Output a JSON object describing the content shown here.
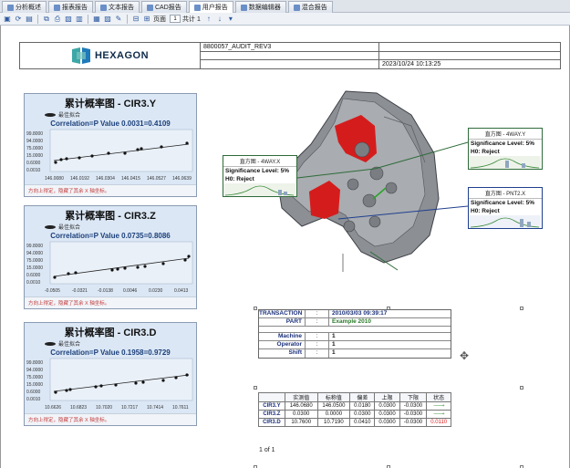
{
  "tabs": [
    {
      "label": "分析概述",
      "active": false
    },
    {
      "label": "报表报告",
      "active": false
    },
    {
      "label": "文本报告",
      "active": false
    },
    {
      "label": "CAD报告",
      "active": false
    },
    {
      "label": "用户报告",
      "active": true
    },
    {
      "label": "数据编辑器",
      "active": false
    },
    {
      "label": "混合报告",
      "active": false
    }
  ],
  "toolbar": {
    "page_label": "页面",
    "page_value": "1",
    "of_label": "共计 1"
  },
  "header": {
    "logo": "HEXAGON",
    "part_name": "8800057_AUDIT_REV3",
    "datetime": "2023/10/24 10:13:25"
  },
  "prob_charts": [
    {
      "title": "累计概率图 - CIR3.Y",
      "legend": "最佳拟合",
      "correlation": "Correlation=P Value 0.0031=0.4109",
      "y_ticks": [
        "99.8000",
        "94.0000",
        "75.0000",
        "15.0000",
        "0.6000",
        "0.0010"
      ],
      "x_ticks": [
        "146.0080",
        "146.0192",
        "146.0304",
        "146.0415",
        "146.0527",
        "146.0639"
      ],
      "note": "方向上得定，隐藏了其余 X 轴坐标。"
    },
    {
      "title": "累计概率图 - CIR3.Z",
      "legend": "最佳拟合",
      "correlation": "Correlation=P Value 0.0735=0.8086",
      "y_ticks": [
        "99.8000",
        "94.0000",
        "75.0000",
        "15.0000",
        "0.6000",
        "0.0010"
      ],
      "x_ticks": [
        "-0.0505",
        "-0.0321",
        "-0.0138",
        "0.0046",
        "0.0230",
        "0.0413"
      ],
      "note": "方向上得定，隐藏了其余 X 轴坐标。"
    },
    {
      "title": "累计概率图 - CIR3.D",
      "legend": "最佳拟合",
      "correlation": "Correlation=P Value 0.1958=0.9729",
      "y_ticks": [
        "99.8000",
        "94.0000",
        "75.0000",
        "15.0000",
        "0.6000",
        "0.0010"
      ],
      "x_ticks": [
        "10.6626",
        "10.6823",
        "10.7020",
        "10.7217",
        "10.7414",
        "10.7611"
      ],
      "note": "方向上得定，隐藏了其余 X 轴坐标。"
    }
  ],
  "callouts": [
    {
      "header": "直方图 - 4WAY.X",
      "l1": "Significance Level: 5%",
      "l2": "H0: Reject",
      "color": "#2e6b3a"
    },
    {
      "header": "直方图 - 4WAY.Y",
      "l1": "Significance Level: 5%",
      "l2": "H0: Reject",
      "color": "#2e6b3a"
    },
    {
      "header": "直方图 - PNT2.X",
      "l1": "Significance Level: 5%",
      "l2": "H0: Reject",
      "color": "#1f3f8e"
    }
  ],
  "transaction": {
    "rows": [
      {
        "key": "TRANSACTION",
        "sep": ":",
        "value": "2010/03/03 09:39:17",
        "style": "blue"
      },
      {
        "key": "PART",
        "sep": ":",
        "value": "Example 2010",
        "style": "green"
      },
      {
        "key": "Machine",
        "sep": ":",
        "value": "1",
        "style": ""
      },
      {
        "key": "Operator",
        "sep": ":",
        "value": "1",
        "style": ""
      },
      {
        "key": "Shift",
        "sep": ":",
        "value": "1",
        "style": ""
      }
    ]
  },
  "results": {
    "headers": [
      "",
      "实测值",
      "标称值",
      "偏差",
      "上限",
      "下限",
      "状态"
    ],
    "rows": [
      {
        "name": "CIR3.Y",
        "cells": [
          "146.0680",
          "146.0500",
          "0.0180",
          "0.0300",
          "-0.0300"
        ],
        "status": "--------+",
        "status_red": false
      },
      {
        "name": "CIR3.Z",
        "cells": [
          "0.0300",
          "0.0000",
          "0.0300",
          "0.0300",
          "-0.0300"
        ],
        "status": "--------+",
        "status_red": false
      },
      {
        "name": "CIR3.D",
        "cells": [
          "10.7600",
          "10.7190",
          "0.0410",
          "0.0300",
          "-0.0300"
        ],
        "status": "0.0110",
        "status_red": true
      }
    ]
  },
  "footer": {
    "page": "1   of   1"
  }
}
